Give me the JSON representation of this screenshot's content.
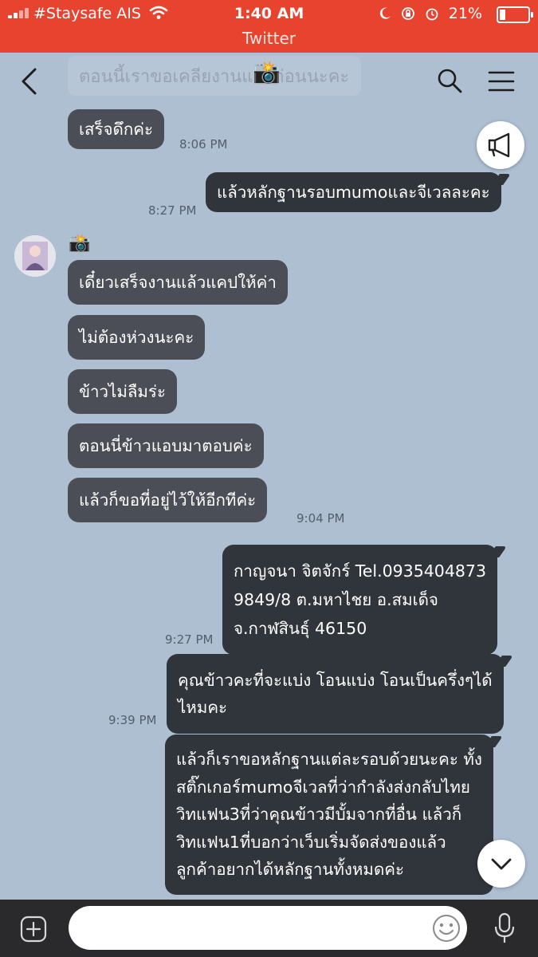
{
  "status_bar": {
    "carrier": "#Staysafe AIS",
    "time": "1:40 AM",
    "battery": "21%",
    "battery_level": 0.21,
    "app_back_label": "Twitter"
  },
  "header": {
    "chat_title": "ตอนนี้เราขอเคลียงานแล้วก่อนนะคะ",
    "title_emoji": "📸"
  },
  "sender": {
    "name_emoji": "📸"
  },
  "messages": [
    {
      "text": "เสร็จดึกค่ะ",
      "time": "8:06 PM"
    },
    {
      "text": "แล้วหลักฐานรอบmumoและจีเวลละคะ",
      "time": "8:27 PM"
    },
    {
      "text": "เดี๋ยวเสร็จงานแล้วแคปให้ค่า"
    },
    {
      "text": "ไม่ต้องห่วงนะคะ"
    },
    {
      "text": "ข้าวไม่ลืมร่ะ"
    },
    {
      "text": "ตอนนี่ข้าวแอบมาตอบค่ะ"
    },
    {
      "text": "แล้วก็ขอที่อยู่ไว้ให้อีกทีค่ะ",
      "time": "9:04 PM"
    },
    {
      "lines": [
        "กาญจนา จิตจักร์ Tel.0935404873",
        "9849/8 ต.มหาไชย อ.สมเด็จ",
        "จ.กาฬสินธุ์ 46150"
      ],
      "time": "9:27 PM"
    },
    {
      "lines": [
        "คุณข้าวคะที่จะแบ่ง โอนแบ่ง โอนเป็นครึ่งๆได้",
        "ไหมคะ"
      ],
      "time": "9:39 PM"
    },
    {
      "lines": [
        "แล้วก็เราขอหลักฐานแต่ละรอบด้วยนะคะ ทั้ง",
        "สติ๊กเกอร์mumoจีเวลที่ว่ากำลังส่งกลับไทย",
        "วิทแฟน3ที่ว่าคุณข้าวมีบั้มจากที่อื่น แล้วก็",
        "วิทแฟน1ที่บอกว่าเว็บเริ่มจัดส่งของแล้ว",
        "ลูกค้าอยากได้หลักฐานทั้งหมดค่ะ"
      ]
    }
  ],
  "input": {
    "value": ""
  },
  "icons": {
    "back": "back-chevron-icon",
    "search": "search-icon",
    "menu": "hamburger-menu-icon",
    "announce": "megaphone-icon",
    "scroll_down": "chevron-down-icon",
    "plus": "plus-icon",
    "emoji": "smiley-icon",
    "mic": "microphone-icon"
  }
}
